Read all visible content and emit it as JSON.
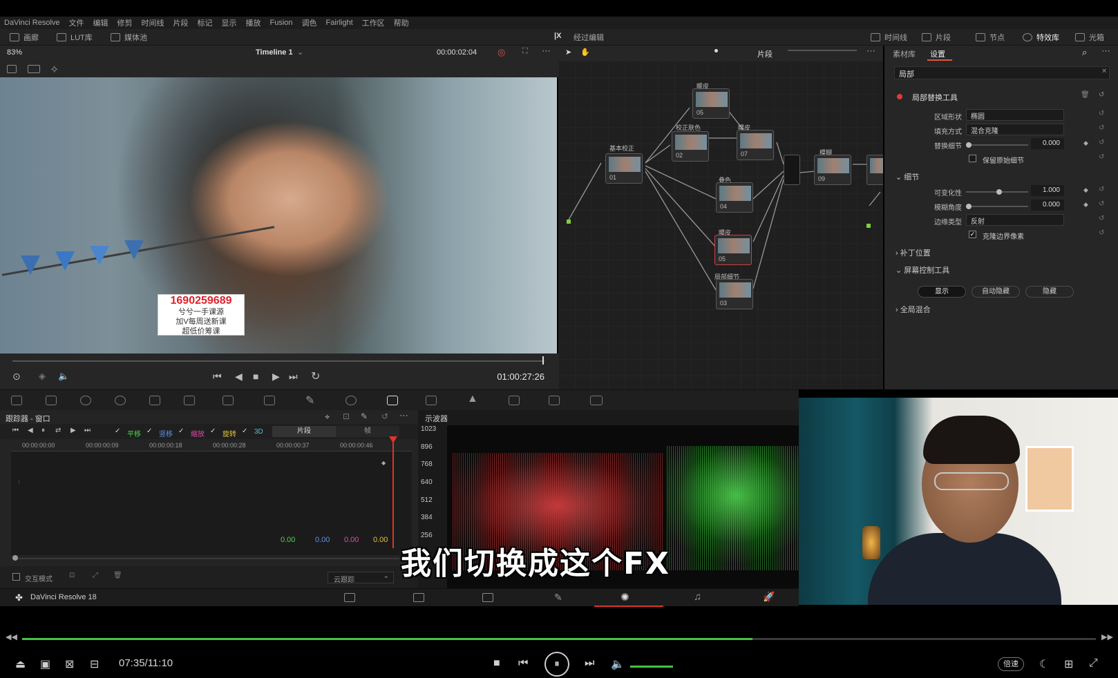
{
  "app": {
    "title": "DaVinci Resolve",
    "footer_name": "DaVinci Resolve 18"
  },
  "menu": [
    "文件",
    "编辑",
    "修剪",
    "时间线",
    "片段",
    "标记",
    "显示",
    "播放",
    "Fusion",
    "调色",
    "Fairlight",
    "工作区",
    "帮助"
  ],
  "toolbar": {
    "left": [
      "画廊",
      "LUT库",
      "媒体池"
    ],
    "center": "经过编辑",
    "right": [
      "时间线",
      "片段",
      "节点",
      "特效库",
      "光箱"
    ]
  },
  "viewer": {
    "zoom": "83%",
    "timeline_name": "Timeline 1",
    "timecode_top": "00:00:02:04",
    "timecode": "01:00:27:26",
    "watermark_lines": [
      "1690259689",
      "兮兮一手课源",
      "加V每周送新课",
      "超低价筹课"
    ]
  },
  "nodes": {
    "mode": "片段",
    "items": [
      {
        "title": "基本校正",
        "label": "01"
      },
      {
        "title": "校正肤色",
        "label": "02"
      },
      {
        "title": "暖皮",
        "label": "03"
      },
      {
        "title": "叠色",
        "label": "04"
      },
      {
        "title": "暖皮",
        "label": "05"
      },
      {
        "title": "曝皮",
        "label": "06"
      },
      {
        "title": "曝皮",
        "label": "07"
      },
      {
        "title": "模糊",
        "label": "09"
      },
      {
        "title": "局部细节",
        "label": "03"
      }
    ]
  },
  "inspector": {
    "tabs": [
      "素材库",
      "设置"
    ],
    "search": "局部",
    "tool_name": "局部替换工具",
    "fields": [
      {
        "label": "区域形状",
        "value": "椭圆"
      },
      {
        "label": "填充方式",
        "value": "混合克隆"
      },
      {
        "label": "替换细节",
        "value": "0.000"
      }
    ],
    "keep_detail": "保留原始细节",
    "section_detail": "细节",
    "detail_fields": [
      {
        "label": "可变化性",
        "value": "1.000"
      },
      {
        "label": "模糊角度",
        "value": "0.000"
      },
      {
        "label": "边缘类型",
        "value": "反射"
      }
    ],
    "clone_edge": "克隆边界像素",
    "patch_pos": "补丁位置",
    "onscreen": "屏幕控制工具",
    "onscreen_buttons": [
      "显示",
      "自动隐藏",
      "隐藏"
    ],
    "global_blend": "全局混合"
  },
  "tracker": {
    "title": "跟踪器 - 窗口",
    "checks": [
      "平移",
      "竖移",
      "缩放",
      "旋转",
      "3D"
    ],
    "check_colors": [
      "#4fcf4f",
      "#5f8fe6",
      "#e24aa8",
      "#e2c23a",
      "#49c9d9"
    ],
    "segment": [
      "片段",
      "帧"
    ],
    "ruler": [
      "00:00:00:00",
      "00:00:00:09",
      "00:00:00:18",
      "00:00:00:28",
      "00:00:00:37",
      "00:00:00:46"
    ],
    "values": [
      "0.00",
      "0.00",
      "0.00",
      "0.00"
    ],
    "interactive": "交互模式",
    "cloud": "云跟踪"
  },
  "scope": {
    "title": "示波器",
    "ticks": [
      "1023",
      "896",
      "768",
      "640",
      "512",
      "384",
      "256"
    ]
  },
  "caption": "我们切换成这个FX",
  "player": {
    "time": "07:35/11:10",
    "progress": 0.68,
    "speed": "倍速"
  }
}
